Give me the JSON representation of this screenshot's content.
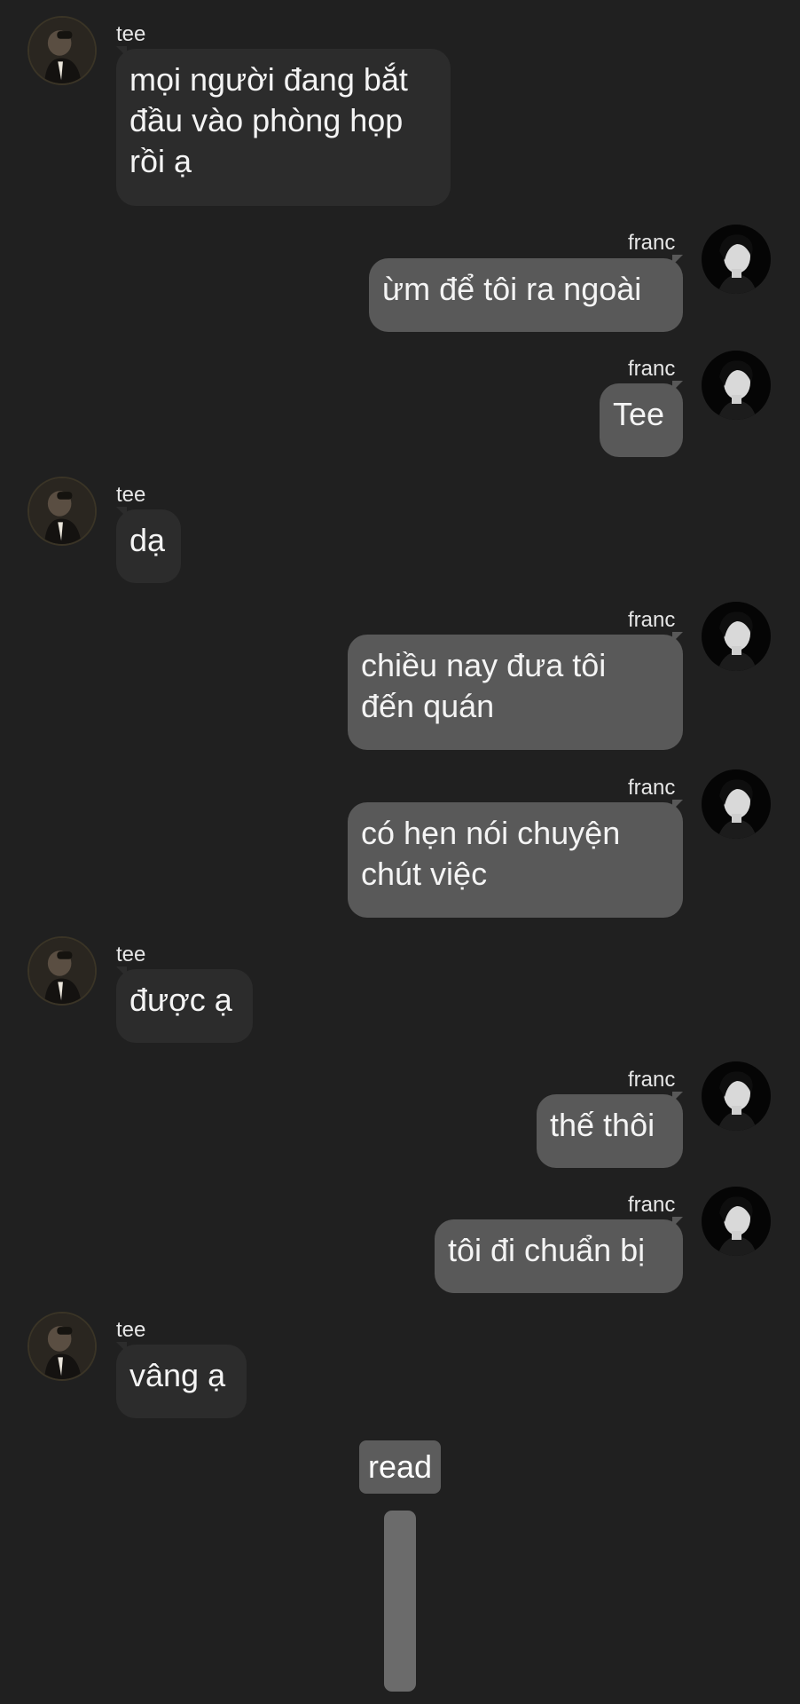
{
  "contacts": {
    "tee": {
      "name": "tee",
      "avatar_icon": "tee-profile-photo-icon"
    },
    "franc": {
      "name": "franc",
      "avatar_icon": "franc-profile-photo-icon"
    }
  },
  "messages": [
    {
      "sender": "tee",
      "name": "tee",
      "lines": [
        "mọi người đang bắt",
        "đầu vào phòng họp",
        "rồi ạ"
      ]
    },
    {
      "sender": "franc",
      "name": "franc",
      "lines": [
        "ừm để tôi ra ngoài"
      ]
    },
    {
      "sender": "franc",
      "name": "franc",
      "lines": [
        "Tee"
      ]
    },
    {
      "sender": "tee",
      "name": "tee",
      "lines": [
        "dạ"
      ]
    },
    {
      "sender": "franc",
      "name": "franc",
      "lines": [
        "chiều nay đưa tôi",
        "đến quán"
      ]
    },
    {
      "sender": "franc",
      "name": "franc",
      "lines": [
        "có hẹn nói chuyện",
        "chút việc"
      ]
    },
    {
      "sender": "tee",
      "name": "tee",
      "lines": [
        "được ạ"
      ]
    },
    {
      "sender": "franc",
      "name": "franc",
      "lines": [
        "thế thôi"
      ]
    },
    {
      "sender": "franc",
      "name": "franc",
      "lines": [
        "tôi đi chuẩn bị"
      ]
    },
    {
      "sender": "tee",
      "name": "tee",
      "lines": [
        "vâng ạ"
      ]
    }
  ],
  "status": {
    "read_label": "read"
  },
  "colors": {
    "background": "#202020",
    "incoming_bubble": "#2c2c2c",
    "outgoing_bubble": "#595959",
    "read_badge": "#5c5c5c",
    "scroll_handle": "#6b6b6b"
  }
}
